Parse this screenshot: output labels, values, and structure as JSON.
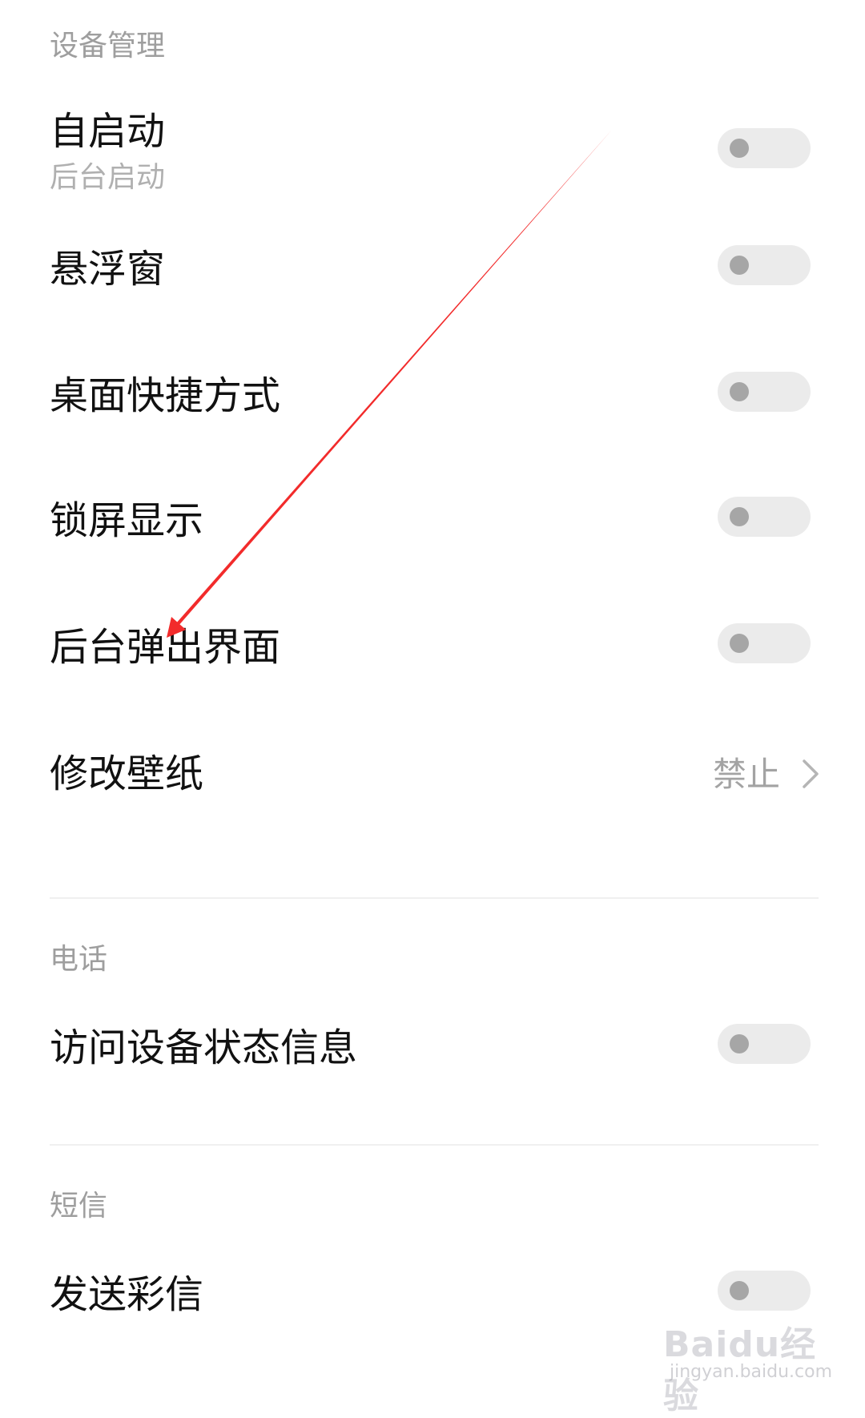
{
  "sections": [
    {
      "header": "设备管理",
      "items": [
        {
          "title": "自启动",
          "subtitle": "后台启动",
          "control": "toggle",
          "on": false
        },
        {
          "title": "悬浮窗",
          "control": "toggle",
          "on": false
        },
        {
          "title": "桌面快捷方式",
          "control": "toggle",
          "on": false
        },
        {
          "title": "锁屏显示",
          "control": "toggle",
          "on": false
        },
        {
          "title": "后台弹出界面",
          "control": "toggle",
          "on": false
        },
        {
          "title": "修改壁纸",
          "control": "value",
          "value": "禁止"
        }
      ]
    },
    {
      "header": "电话",
      "items": [
        {
          "title": "访问设备状态信息",
          "control": "toggle",
          "on": false
        }
      ]
    },
    {
      "header": "短信",
      "items": [
        {
          "title": "发送彩信",
          "control": "toggle",
          "on": false
        }
      ]
    }
  ],
  "icons": {
    "chevron": "chevron-right-icon",
    "annotation": "red-arrow-annotation"
  },
  "colors": {
    "annotation_arrow": "#f22b2b",
    "toggle_off_track": "#ebebeb",
    "toggle_off_knob": "#a6a6a6"
  },
  "watermark": {
    "brand": "Baidu经验",
    "url": "jingyan.baidu.com"
  }
}
